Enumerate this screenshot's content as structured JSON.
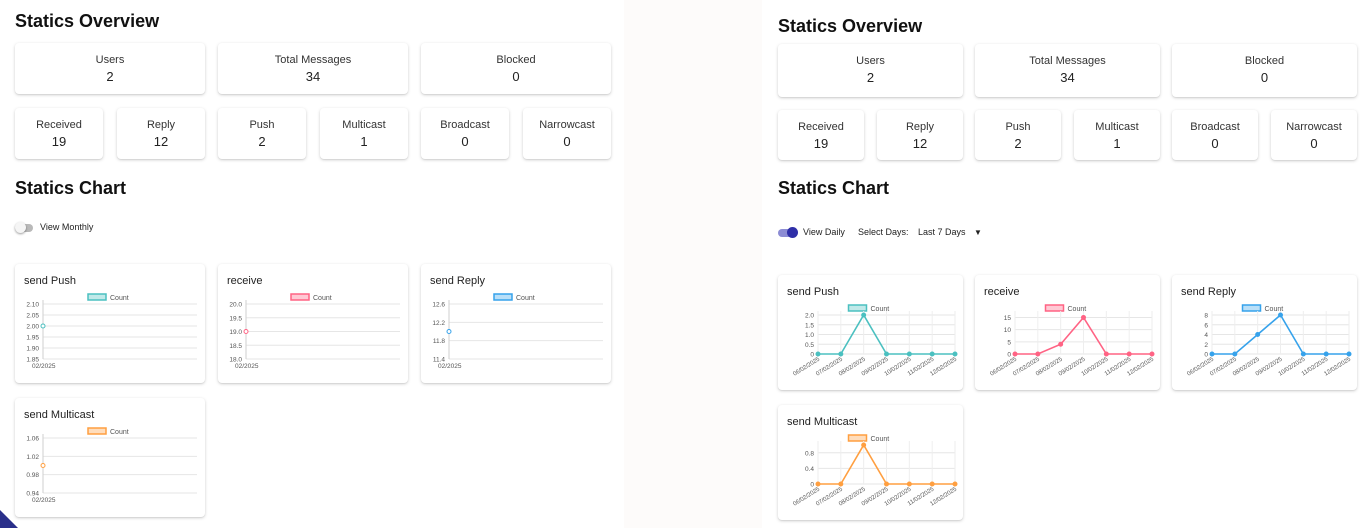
{
  "colors": {
    "push": "#4bc0c0",
    "receive": "#ff6384",
    "reply": "#36a2eb",
    "multicast": "#ff9f40",
    "toggle_on": "#3f3fb0"
  },
  "left": {
    "overview_title": "Statics Overview",
    "stats_top": [
      {
        "label": "Users",
        "value": "2"
      },
      {
        "label": "Total Messages",
        "value": "34"
      },
      {
        "label": "Blocked",
        "value": "0"
      }
    ],
    "stats_bottom": [
      {
        "label": "Received",
        "value": "19"
      },
      {
        "label": "Reply",
        "value": "12"
      },
      {
        "label": "Push",
        "value": "2"
      },
      {
        "label": "Multicast",
        "value": "1"
      },
      {
        "label": "Broadcast",
        "value": "0"
      },
      {
        "label": "Narrowcast",
        "value": "0"
      }
    ],
    "chart_title": "Statics Chart",
    "toggle": {
      "label": "View Monthly",
      "on": false
    }
  },
  "right": {
    "overview_title": "Statics Overview",
    "stats_top": [
      {
        "label": "Users",
        "value": "2"
      },
      {
        "label": "Total Messages",
        "value": "34"
      },
      {
        "label": "Blocked",
        "value": "0"
      }
    ],
    "stats_bottom": [
      {
        "label": "Received",
        "value": "19"
      },
      {
        "label": "Reply",
        "value": "12"
      },
      {
        "label": "Push",
        "value": "2"
      },
      {
        "label": "Multicast",
        "value": "1"
      },
      {
        "label": "Broadcast",
        "value": "0"
      },
      {
        "label": "Narrowcast",
        "value": "0"
      }
    ],
    "chart_title": "Statics Chart",
    "toggle": {
      "label": "View Daily",
      "on": true
    },
    "select": {
      "label": "Select Days:",
      "value": "Last 7 Days",
      "icon": "chevron-down-icon"
    }
  },
  "chart_data": [
    {
      "panel": "left",
      "title": "send Push",
      "type": "line",
      "legend": "Count",
      "color": "push",
      "categories": [
        "02/2025"
      ],
      "values": [
        2.0
      ],
      "yticks": [
        2.1,
        2.05,
        2.0,
        1.95,
        1.9,
        1.85
      ],
      "ylim": [
        1.85,
        2.1
      ],
      "ytick_labels": [
        "2.10",
        "2.05",
        "2.00",
        "1.95",
        "1.90",
        "1.85"
      ]
    },
    {
      "panel": "left",
      "title": "receive",
      "type": "line",
      "legend": "Count",
      "color": "receive",
      "categories": [
        "02/2025"
      ],
      "values": [
        19
      ],
      "yticks": [
        20.0,
        19.5,
        19.0,
        18.5,
        18.0
      ],
      "ylim": [
        18.0,
        20.0
      ],
      "ytick_labels": [
        "20.0",
        "19.5",
        "19.0",
        "18.5",
        "18.0"
      ]
    },
    {
      "panel": "left",
      "title": "send Reply",
      "type": "line",
      "legend": "Count",
      "color": "reply",
      "categories": [
        "02/2025"
      ],
      "values": [
        12
      ],
      "yticks": [
        12.6,
        12.2,
        11.8,
        11.4
      ],
      "ylim": [
        11.4,
        12.6
      ],
      "ytick_labels": [
        "12.6",
        "12.2",
        "11.8",
        "11.4"
      ]
    },
    {
      "panel": "left",
      "title": "send Multicast",
      "type": "line",
      "legend": "Count",
      "color": "multicast",
      "categories": [
        "02/2025"
      ],
      "values": [
        1
      ],
      "yticks": [
        1.06,
        1.02,
        0.98,
        0.94
      ],
      "ylim": [
        0.94,
        1.06
      ],
      "ytick_labels": [
        "1.06",
        "1.02",
        "0.98",
        "0.94"
      ]
    },
    {
      "panel": "right",
      "title": "send Push",
      "type": "line",
      "legend": "Count",
      "color": "push",
      "categories": [
        "06/02/2025",
        "07/02/2025",
        "08/02/2025",
        "09/02/2025",
        "10/02/2025",
        "11/02/2025",
        "12/02/2025"
      ],
      "values": [
        0,
        0,
        2,
        0,
        0,
        0,
        0
      ],
      "yticks": [
        2.0,
        1.5,
        1.0,
        0.5,
        0
      ],
      "ylim": [
        0,
        2.0
      ],
      "ytick_labels": [
        "2.0",
        "1.5",
        "1.0",
        "0.5",
        "0"
      ]
    },
    {
      "panel": "right",
      "title": "receive",
      "type": "line",
      "legend": "Count",
      "color": "receive",
      "categories": [
        "06/02/2025",
        "07/02/2025",
        "08/02/2025",
        "09/02/2025",
        "10/02/2025",
        "11/02/2025",
        "12/02/2025"
      ],
      "values": [
        0,
        0,
        4,
        15,
        0,
        0,
        0
      ],
      "yticks": [
        15,
        10,
        5,
        0
      ],
      "ylim": [
        0,
        16
      ],
      "ytick_labels": [
        "15",
        "10",
        "5",
        "0"
      ]
    },
    {
      "panel": "right",
      "title": "send Reply",
      "type": "line",
      "legend": "Count",
      "color": "reply",
      "categories": [
        "06/02/2025",
        "07/02/2025",
        "08/02/2025",
        "09/02/2025",
        "10/02/2025",
        "11/02/2025",
        "12/02/2025"
      ],
      "values": [
        0,
        0,
        4,
        8,
        0,
        0,
        0
      ],
      "yticks": [
        8,
        6,
        4,
        2,
        0
      ],
      "ylim": [
        0,
        8
      ],
      "ytick_labels": [
        "8",
        "6",
        "4",
        "2",
        "0"
      ]
    },
    {
      "panel": "right",
      "title": "send Multicast",
      "type": "line",
      "legend": "Count",
      "color": "multicast",
      "categories": [
        "06/02/2025",
        "07/02/2025",
        "08/02/2025",
        "09/02/2025",
        "10/02/2025",
        "11/02/2025",
        "12/02/2025"
      ],
      "values": [
        0,
        0,
        1,
        0,
        0,
        0,
        0
      ],
      "yticks": [
        0.8,
        0.4,
        0
      ],
      "ylim": [
        0,
        1.0
      ],
      "ytick_labels": [
        "0.8",
        "0.4",
        "0"
      ]
    }
  ]
}
